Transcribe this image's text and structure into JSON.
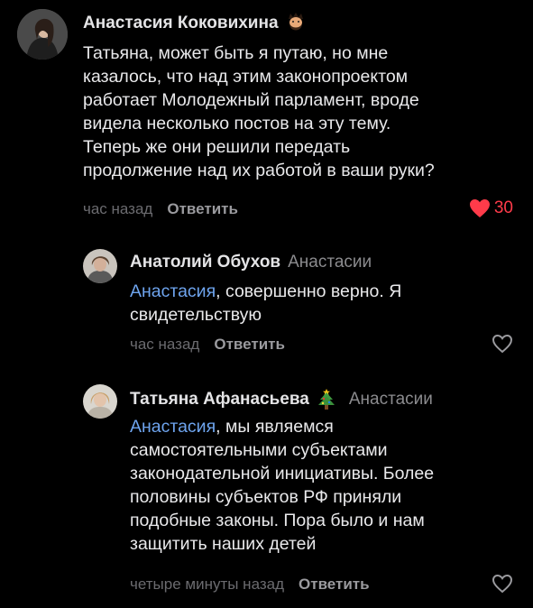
{
  "comments": [
    {
      "author": "Анастасия Коковихина",
      "text_lines": [
        "Татьяна, может быть я путаю, но мне",
        "казалось, что над этим законопроектом",
        "работает Молодежный парламент, вроде",
        "видела несколько постов на эту тему.",
        "Теперь же они решили передать",
        "продолжение над их работой в ваши руки?"
      ],
      "time": "час назад",
      "reply_label": "Ответить",
      "likes": "30",
      "liked": true,
      "badge_icon": "bearded-face-emoji-icon"
    },
    {
      "author": "Анатолий Обухов",
      "reply_to": "Анастасии",
      "mention": "Анастасия",
      "text_first": ", совершенно верно. Я",
      "text_lines": [
        "свидетельствую"
      ],
      "time": "час назад",
      "reply_label": "Ответить",
      "liked": false
    },
    {
      "author": "Татьяна Афанасьева",
      "reply_to": "Анастасии",
      "badge_icon": "christmas-tree-emoji-icon",
      "mention": "Анастасия",
      "text_first": ", мы являемся",
      "text_lines": [
        "самостоятельными субъектами",
        "законодательной инициативы. Более",
        "половины субъектов РФ приняли",
        "подобные законы. Пора было и нам",
        "защитить наших детей"
      ],
      "time": "четыре минуты назад",
      "reply_label": "Ответить",
      "liked": false
    }
  ],
  "colors": {
    "background": "#000000",
    "mention": "#6ea4ee",
    "like_active": "#ff3b4a",
    "muted": "#6b6b6f"
  }
}
